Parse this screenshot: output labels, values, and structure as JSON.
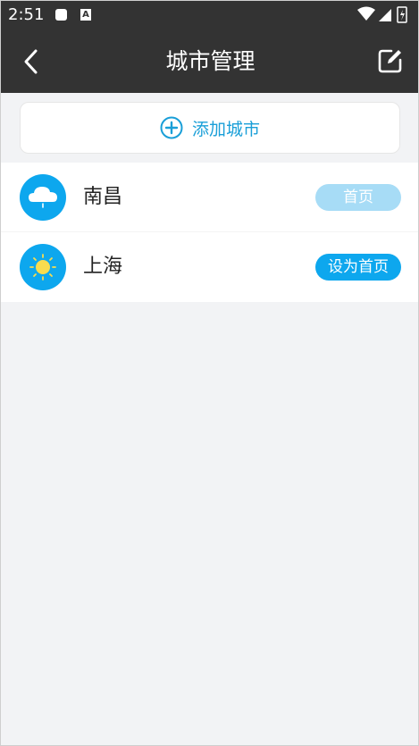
{
  "status_bar": {
    "time": "2:51",
    "notif_icon_b": "A"
  },
  "header": {
    "title": "城市管理",
    "back_icon": "chevron-left-icon",
    "edit_icon": "edit-icon"
  },
  "add_city": {
    "label": "添加城市",
    "icon": "plus-circle-icon"
  },
  "cities": [
    {
      "name": "南昌",
      "weather_icon": "cloud-rain-icon",
      "button_label": "首页",
      "is_home": true
    },
    {
      "name": "上海",
      "weather_icon": "sun-icon",
      "button_label": "设为首页",
      "is_home": false
    }
  ],
  "colors": {
    "header_bg": "#333333",
    "accent": "#0da7ee",
    "accent_light": "#a7dcf6",
    "page_bg": "#f2f3f5"
  }
}
